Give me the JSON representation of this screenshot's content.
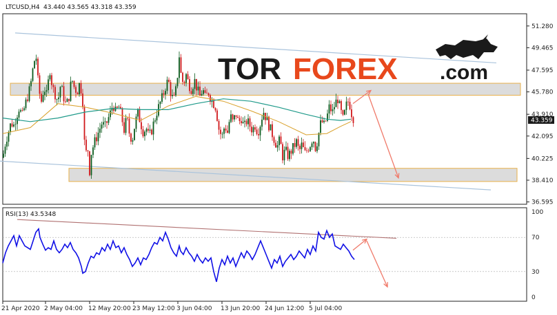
{
  "header": {
    "symbol": "LTCUSD,H4",
    "ohlc": "43.440 43.565 43.318 43.359"
  },
  "logo": {
    "part1": "TOR",
    "part2": "FOREX",
    "part3": ".com"
  },
  "rsi": {
    "label": "RSI(13) 43.5348"
  },
  "colors": {
    "bull": "#0b5a1c",
    "bear": "#d0181b",
    "ma_fast": "#d9a02a",
    "ma_slow": "#1f9a8a",
    "rsi": "#1010e6",
    "zone": "#d6d6d6",
    "zone_border": "#e8b04a",
    "arrow": "#f07a6a",
    "channel": "#a9c3dc",
    "rsi_trend": "#b07070"
  },
  "chart_data": [
    {
      "type": "candlestick",
      "title": "LTCUSD,H4",
      "price_label": "43.359",
      "y_ticks": [
        "51.280",
        "49.465",
        "47.595",
        "45.780",
        "43.910",
        "42.095",
        "40.225",
        "38.410",
        "36.595"
      ],
      "x_ticks": [
        "21 Apr 2020",
        "2 May 04:00",
        "12 May 20:00",
        "23 May 12:00",
        "3 Jun 04:00",
        "13 Jun 20:00",
        "24 Jun 12:00",
        "5 Jul 04:00"
      ],
      "ylim": [
        36.4,
        52.3
      ],
      "close_path": [
        [
          0,
          40.3
        ],
        [
          4,
          41.6
        ],
        [
          8,
          42.4
        ],
        [
          12,
          43.2
        ],
        [
          16,
          43.0
        ],
        [
          20,
          43.8
        ],
        [
          24,
          44.5
        ],
        [
          28,
          43.7
        ],
        [
          32,
          44.6
        ],
        [
          36,
          45.4
        ],
        [
          40,
          46.2
        ],
        [
          44,
          47.8
        ],
        [
          48,
          49.0
        ],
        [
          50,
          47.5
        ],
        [
          52,
          46.0
        ],
        [
          56,
          45.0
        ],
        [
          60,
          46.2
        ],
        [
          64,
          45.4
        ],
        [
          68,
          47.8
        ],
        [
          72,
          46.2
        ],
        [
          76,
          45.6
        ],
        [
          80,
          45.0
        ],
        [
          84,
          46.4
        ],
        [
          88,
          45.4
        ],
        [
          92,
          44.6
        ],
        [
          96,
          45.4
        ],
        [
          100,
          46.9
        ],
        [
          104,
          46.1
        ],
        [
          108,
          45.8
        ],
        [
          112,
          46.6
        ],
        [
          116,
          45.0
        ],
        [
          118,
          41.9
        ],
        [
          120,
          40.6
        ],
        [
          124,
          41.0
        ],
        [
          126,
          39.2
        ],
        [
          128,
          40.6
        ],
        [
          132,
          41.4
        ],
        [
          136,
          42.0
        ],
        [
          140,
          42.6
        ],
        [
          144,
          43.2
        ],
        [
          148,
          42.8
        ],
        [
          152,
          43.4
        ],
        [
          156,
          44.0
        ],
        [
          160,
          44.8
        ],
        [
          164,
          44.0
        ],
        [
          168,
          44.6
        ],
        [
          172,
          43.8
        ],
        [
          176,
          42.6
        ],
        [
          180,
          43.6
        ],
        [
          184,
          42.2
        ],
        [
          188,
          41.8
        ],
        [
          192,
          43.2
        ],
        [
          196,
          44.0
        ],
        [
          200,
          43.2
        ],
        [
          204,
          42.4
        ],
        [
          208,
          42.8
        ],
        [
          212,
          42.0
        ],
        [
          216,
          42.6
        ],
        [
          220,
          43.4
        ],
        [
          224,
          44.2
        ],
        [
          228,
          44.8
        ],
        [
          232,
          45.4
        ],
        [
          236,
          46.2
        ],
        [
          240,
          46.8
        ],
        [
          244,
          45.6
        ],
        [
          248,
          45.0
        ],
        [
          252,
          46.2
        ],
        [
          256,
          48.8
        ],
        [
          258,
          47.4
        ],
        [
          262,
          46.4
        ],
        [
          266,
          47.2
        ],
        [
          270,
          46.4
        ],
        [
          274,
          46.0
        ],
        [
          278,
          46.8
        ],
        [
          282,
          46.0
        ],
        [
          286,
          45.4
        ],
        [
          290,
          46.0
        ],
        [
          294,
          45.2
        ],
        [
          298,
          45.8
        ],
        [
          302,
          45.2
        ],
        [
          306,
          44.8
        ],
        [
          310,
          44.4
        ],
        [
          312,
          43.0
        ],
        [
          314,
          42.6
        ],
        [
          318,
          42.0
        ],
        [
          322,
          43.0
        ],
        [
          326,
          42.4
        ],
        [
          330,
          43.8
        ],
        [
          334,
          43.2
        ],
        [
          338,
          44.0
        ],
        [
          342,
          43.2
        ],
        [
          346,
          43.6
        ],
        [
          350,
          42.8
        ],
        [
          354,
          43.4
        ],
        [
          358,
          43.0
        ],
        [
          362,
          42.6
        ],
        [
          366,
          43.0
        ],
        [
          370,
          42.4
        ],
        [
          374,
          43.2
        ],
        [
          378,
          44.2
        ],
        [
          382,
          43.6
        ],
        [
          386,
          43.0
        ],
        [
          390,
          42.4
        ],
        [
          394,
          41.8
        ],
        [
          398,
          41.2
        ],
        [
          402,
          41.8
        ],
        [
          406,
          40.4
        ],
        [
          410,
          40.9
        ],
        [
          414,
          40.4
        ],
        [
          418,
          40.8
        ],
        [
          422,
          41.2
        ],
        [
          426,
          41.6
        ],
        [
          430,
          40.8
        ],
        [
          434,
          41.4
        ],
        [
          438,
          40.6
        ],
        [
          442,
          41.0
        ],
        [
          446,
          41.4
        ],
        [
          450,
          42.0
        ],
        [
          454,
          41.0
        ],
        [
          458,
          42.2
        ],
        [
          462,
          43.4
        ],
        [
          466,
          43.0
        ],
        [
          470,
          43.6
        ],
        [
          474,
          44.6
        ],
        [
          478,
          44.0
        ],
        [
          482,
          44.8
        ],
        [
          486,
          45.2
        ],
        [
          490,
          44.2
        ],
        [
          494,
          43.4
        ],
        [
          498,
          44.6
        ],
        [
          502,
          45.1
        ],
        [
          506,
          44.0
        ],
        [
          510,
          43.4
        ]
      ],
      "ma_fast_path": [
        [
          0,
          42.3
        ],
        [
          40,
          42.8
        ],
        [
          80,
          44.8
        ],
        [
          120,
          44.5
        ],
        [
          160,
          44.0
        ],
        [
          200,
          43.4
        ],
        [
          240,
          44.6
        ],
        [
          280,
          45.4
        ],
        [
          320,
          45.0
        ],
        [
          360,
          44.2
        ],
        [
          400,
          43.3
        ],
        [
          440,
          42.2
        ],
        [
          470,
          42.3
        ],
        [
          490,
          42.9
        ],
        [
          505,
          43.3
        ]
      ],
      "ma_slow_path": [
        [
          0,
          43.6
        ],
        [
          40,
          43.3
        ],
        [
          80,
          43.6
        ],
        [
          120,
          44.1
        ],
        [
          160,
          44.4
        ],
        [
          200,
          44.3
        ],
        [
          240,
          44.3
        ],
        [
          280,
          44.8
        ],
        [
          320,
          45.2
        ],
        [
          360,
          45.0
        ],
        [
          400,
          44.5
        ],
        [
          440,
          43.9
        ],
        [
          470,
          43.5
        ],
        [
          490,
          43.4
        ],
        [
          505,
          43.5
        ]
      ],
      "zones": [
        {
          "from": 45.5,
          "to": 46.5,
          "x_start": 15,
          "x_end": 755
        },
        {
          "from": 38.3,
          "to": 39.4,
          "x_start": 100,
          "x_end": 750
        }
      ],
      "channel_lines": [
        {
          "x1": 22,
          "y1": 50.7,
          "x2": 720,
          "y2": 48.2
        },
        {
          "x1": 0,
          "y1": 40.0,
          "x2": 712,
          "y2": 37.6
        }
      ],
      "forecast_arrows": [
        {
          "x1": 512,
          "y1": 44.8,
          "x2": 538,
          "y2": 45.9
        },
        {
          "x1": 534,
          "y1": 45.6,
          "x2": 578,
          "y2": 38.6
        }
      ]
    },
    {
      "type": "line",
      "title": "RSI(13) 43.5348",
      "y_ticks": [
        "100",
        "70",
        "30",
        "0"
      ],
      "ylim": [
        0,
        100
      ],
      "levels": [
        70,
        30
      ],
      "series": [
        {
          "points": [
            [
              0,
              40
            ],
            [
              4,
              52
            ],
            [
              8,
              60
            ],
            [
              12,
              66
            ],
            [
              16,
              72
            ],
            [
              20,
              60
            ],
            [
              24,
              72
            ],
            [
              28,
              66
            ],
            [
              32,
              60
            ],
            [
              36,
              58
            ],
            [
              40,
              56
            ],
            [
              44,
              66
            ],
            [
              48,
              76
            ],
            [
              52,
              80
            ],
            [
              54,
              70
            ],
            [
              58,
              62
            ],
            [
              62,
              55
            ],
            [
              66,
              58
            ],
            [
              70,
              56
            ],
            [
              74,
              66
            ],
            [
              78,
              56
            ],
            [
              82,
              52
            ],
            [
              86,
              56
            ],
            [
              90,
              62
            ],
            [
              94,
              58
            ],
            [
              98,
              64
            ],
            [
              102,
              56
            ],
            [
              106,
              52
            ],
            [
              110,
              46
            ],
            [
              114,
              36
            ],
            [
              116,
              28
            ],
            [
              120,
              30
            ],
            [
              124,
              40
            ],
            [
              128,
              48
            ],
            [
              132,
              46
            ],
            [
              136,
              52
            ],
            [
              140,
              50
            ],
            [
              144,
              58
            ],
            [
              148,
              54
            ],
            [
              152,
              62
            ],
            [
              156,
              56
            ],
            [
              160,
              66
            ],
            [
              164,
              58
            ],
            [
              168,
              60
            ],
            [
              172,
              52
            ],
            [
              176,
              58
            ],
            [
              180,
              50
            ],
            [
              184,
              44
            ],
            [
              188,
              36
            ],
            [
              192,
              40
            ],
            [
              196,
              46
            ],
            [
              200,
              38
            ],
            [
              204,
              46
            ],
            [
              208,
              44
            ],
            [
              212,
              50
            ],
            [
              216,
              58
            ],
            [
              220,
              64
            ],
            [
              224,
              62
            ],
            [
              228,
              70
            ],
            [
              232,
              66
            ],
            [
              236,
              76
            ],
            [
              240,
              68
            ],
            [
              244,
              58
            ],
            [
              248,
              52
            ],
            [
              252,
              48
            ],
            [
              256,
              60
            ],
            [
              258,
              54
            ],
            [
              262,
              50
            ],
            [
              266,
              58
            ],
            [
              270,
              52
            ],
            [
              274,
              48
            ],
            [
              278,
              42
            ],
            [
              282,
              50
            ],
            [
              286,
              44
            ],
            [
              290,
              40
            ],
            [
              294,
              46
            ],
            [
              298,
              42
            ],
            [
              302,
              46
            ],
            [
              306,
              30
            ],
            [
              310,
              18
            ],
            [
              314,
              34
            ],
            [
              318,
              44
            ],
            [
              322,
              38
            ],
            [
              326,
              48
            ],
            [
              330,
              40
            ],
            [
              334,
              46
            ],
            [
              338,
              36
            ],
            [
              342,
              44
            ],
            [
              346,
              52
            ],
            [
              350,
              46
            ],
            [
              354,
              54
            ],
            [
              358,
              50
            ],
            [
              362,
              44
            ],
            [
              366,
              50
            ],
            [
              370,
              58
            ],
            [
              374,
              66
            ],
            [
              378,
              58
            ],
            [
              382,
              50
            ],
            [
              386,
              42
            ],
            [
              390,
              34
            ],
            [
              394,
              44
            ],
            [
              398,
              40
            ],
            [
              402,
              48
            ],
            [
              406,
              36
            ],
            [
              410,
              42
            ],
            [
              414,
              46
            ],
            [
              418,
              50
            ],
            [
              422,
              44
            ],
            [
              426,
              48
            ],
            [
              430,
              54
            ],
            [
              434,
              50
            ],
            [
              438,
              46
            ],
            [
              442,
              56
            ],
            [
              446,
              50
            ],
            [
              450,
              60
            ],
            [
              454,
              54
            ],
            [
              458,
              76
            ],
            [
              462,
              70
            ],
            [
              466,
              68
            ],
            [
              470,
              78
            ],
            [
              474,
              70
            ],
            [
              478,
              74
            ],
            [
              482,
              60
            ],
            [
              486,
              58
            ],
            [
              490,
              56
            ],
            [
              494,
              62
            ],
            [
              498,
              58
            ],
            [
              502,
              54
            ],
            [
              506,
              48
            ],
            [
              510,
              44
            ]
          ]
        }
      ],
      "trend_line": {
        "x1": 25,
        "y1": 91,
        "x2": 575,
        "y2": 69
      },
      "forecast_arrows": [
        {
          "x1": 512,
          "y1": 55,
          "x2": 532,
          "y2": 68
        },
        {
          "x1": 532,
          "y1": 66,
          "x2": 562,
          "y2": 12
        }
      ]
    }
  ]
}
